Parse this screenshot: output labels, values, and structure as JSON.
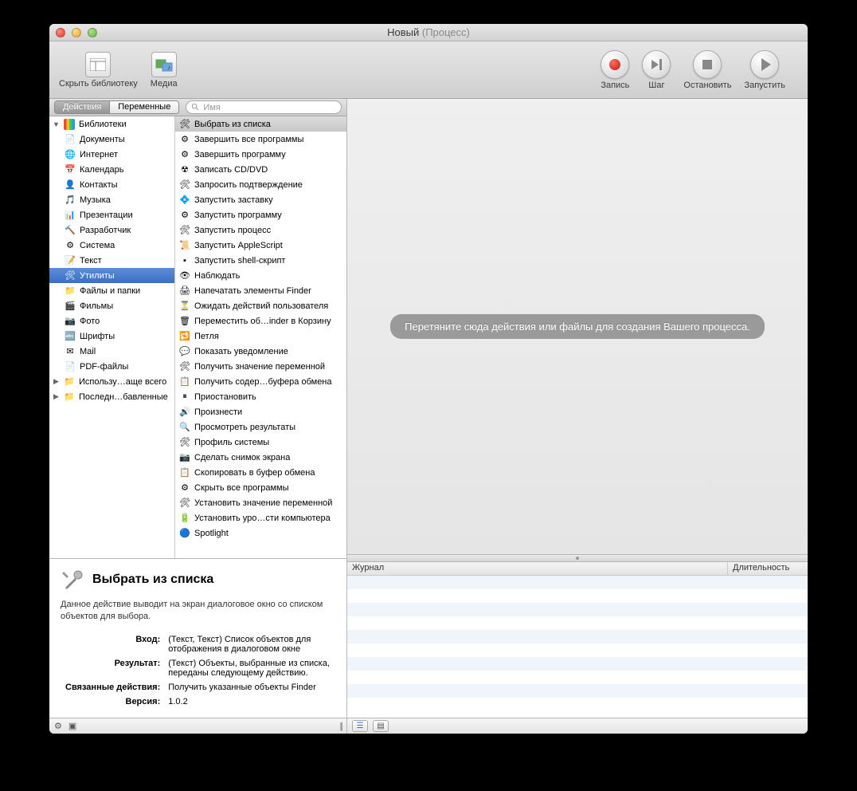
{
  "window": {
    "title": "Новый",
    "subtitle": "(Процесс)"
  },
  "toolbar": {
    "hide_library": "Скрыть библиотеку",
    "media": "Медиа",
    "record": "Запись",
    "step": "Шаг",
    "stop": "Остановить",
    "run": "Запустить"
  },
  "tabs": {
    "actions": "Действия",
    "variables": "Переменные"
  },
  "search": {
    "placeholder": "Имя"
  },
  "categories": {
    "root": "Библиотеки",
    "items": [
      "Документы",
      "Интернет",
      "Календарь",
      "Контакты",
      "Музыка",
      "Презентации",
      "Разработчик",
      "Система",
      "Текст",
      "Утилиты",
      "Файлы и папки",
      "Фильмы",
      "Фото",
      "Шрифты",
      "Mail",
      "PDF-файлы"
    ],
    "extra": [
      "Использу…аще всего",
      "Последн…бавленные"
    ],
    "selected_index": 9
  },
  "actions": {
    "selected_index": 0,
    "items": [
      "Выбрать из списка",
      "Завершить все программы",
      "Завершить программу",
      "Записать CD/DVD",
      "Запросить подтверждение",
      "Запустить заставку",
      "Запустить программу",
      "Запустить процесс",
      "Запустить AppleScript",
      "Запустить shell-скрипт",
      "Наблюдать",
      "Напечатать элементы Finder",
      "Ожидать действий пользователя",
      "Переместить об…inder в Корзину",
      "Петля",
      "Показать уведомление",
      "Получить значение переменной",
      "Получить содер…буфера обмена",
      "Приостановить",
      "Произнести",
      "Просмотреть результаты",
      "Профиль системы",
      "Сделать снимок экрана",
      "Скопировать в буфер обмена",
      "Скрыть все программы",
      "Установить значение переменной",
      "Установить уро…сти компьютера",
      "Spotlight"
    ]
  },
  "details": {
    "title": "Выбрать из списка",
    "description": "Данное действие выводит на экран диалоговое окно со списком объектов для выбора.",
    "input_label": "Вход:",
    "input_value": "(Текст, Текст) Список объектов для отображения в диалоговом окне",
    "result_label": "Результат:",
    "result_value": "(Текст) Объекты, выбранные из списка, переданы следующему действию.",
    "related_label": "Связанные действия:",
    "related_value": "Получить указанные объекты Finder",
    "version_label": "Версия:",
    "version_value": "1.0.2"
  },
  "canvas": {
    "placeholder": "Перетяните сюда действия или файлы для создания Вашего процесса."
  },
  "log": {
    "col_journal": "Журнал",
    "col_duration": "Длительность"
  },
  "icons": {
    "categories": [
      "📄",
      "🌐",
      "📅",
      "👤",
      "🎵",
      "📊",
      "🔨",
      "⚙",
      "📝",
      "🛠",
      "📁",
      "🎬",
      "📷",
      "🔤",
      "✉",
      "📄"
    ],
    "extra": [
      "📁",
      "📁"
    ],
    "actions": [
      "🛠",
      "⚙",
      "⚙",
      "☢",
      "🛠",
      "💠",
      "⚙",
      "🛠",
      "📜",
      "▪",
      "👁",
      "🖨",
      "⏳",
      "🗑",
      "🔁",
      "💬",
      "🛠",
      "📋",
      "⏸",
      "🔊",
      "🔍",
      "🛠",
      "📷",
      "📋",
      "⚙",
      "🛠",
      "🔋",
      "🔵"
    ]
  }
}
